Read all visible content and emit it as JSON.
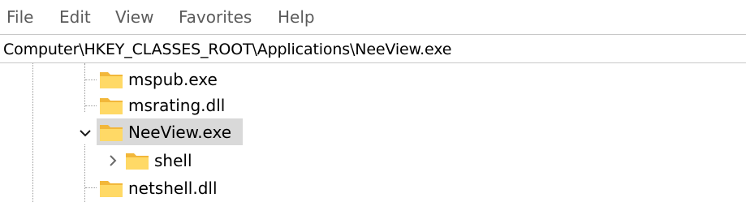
{
  "menu": {
    "items": [
      {
        "label": "File"
      },
      {
        "label": "Edit"
      },
      {
        "label": "View"
      },
      {
        "label": "Favorites"
      },
      {
        "label": "Help"
      }
    ]
  },
  "address": {
    "path": "Computer\\HKEY_CLASSES_ROOT\\Applications\\NeeView.exe"
  },
  "tree": {
    "nodes": [
      {
        "label": "mspub.exe",
        "icon": "folder-icon",
        "expanded": false,
        "selected": false
      },
      {
        "label": "msrating.dll",
        "icon": "folder-icon",
        "expanded": false,
        "selected": false
      },
      {
        "label": "NeeView.exe",
        "icon": "folder-icon",
        "expanded": true,
        "selected": true
      },
      {
        "label": "shell",
        "icon": "folder-icon",
        "expanded": false,
        "selected": false,
        "child": true
      },
      {
        "label": "netshell.dll",
        "icon": "folder-icon",
        "expanded": false,
        "selected": false
      }
    ]
  },
  "colors": {
    "selection": "#d9d9d9",
    "folder_body": "#f7c84a",
    "folder_front": "#ffd966",
    "menu_text": "#5b5b5b"
  }
}
